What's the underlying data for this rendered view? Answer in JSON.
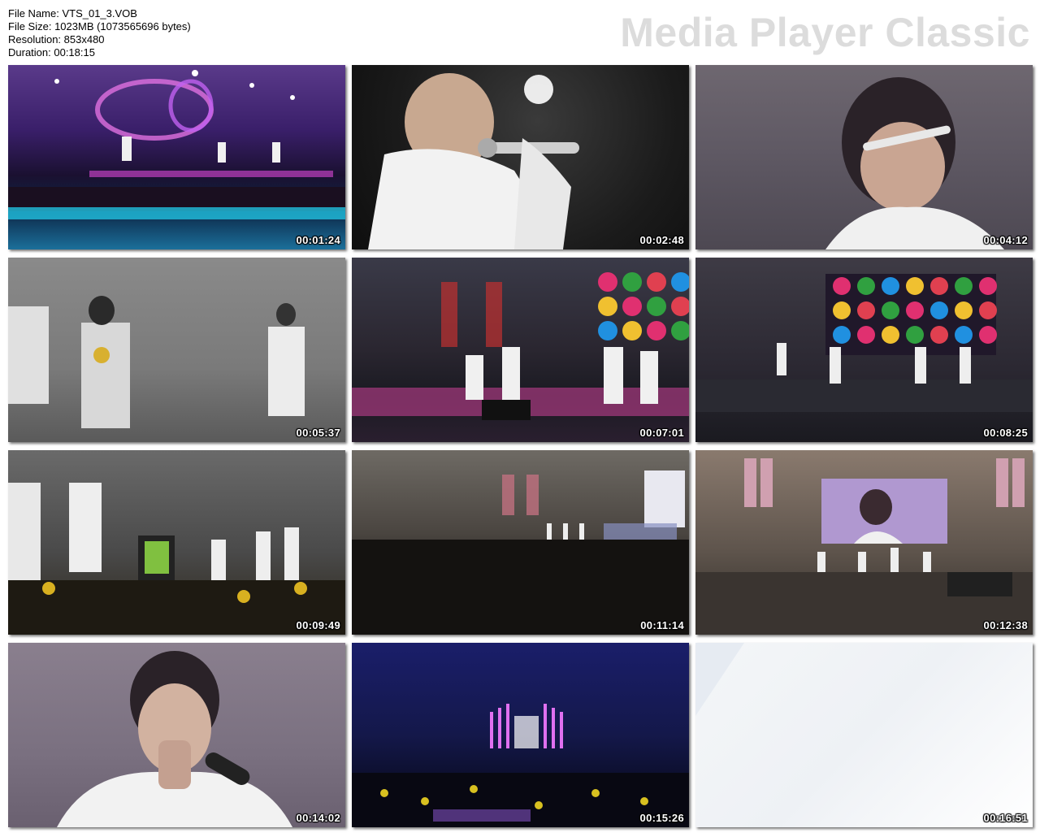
{
  "file_info": {
    "file_name": "File Name: VTS_01_3.VOB",
    "file_size": "File Size: 1023MB (1073565696 bytes)",
    "resolution": "Resolution: 853x480",
    "duration": "Duration: 00:18:15"
  },
  "brand": "Media Player Classic",
  "thumbnails": [
    {
      "timestamp": "00:01:24"
    },
    {
      "timestamp": "00:02:48"
    },
    {
      "timestamp": "00:04:12"
    },
    {
      "timestamp": "00:05:37"
    },
    {
      "timestamp": "00:07:01"
    },
    {
      "timestamp": "00:08:25"
    },
    {
      "timestamp": "00:09:49"
    },
    {
      "timestamp": "00:11:14"
    },
    {
      "timestamp": "00:12:38"
    },
    {
      "timestamp": "00:14:02"
    },
    {
      "timestamp": "00:15:26"
    },
    {
      "timestamp": "00:16:51"
    }
  ],
  "colors": {
    "brand_text": "#dcdcdc",
    "timestamp_text": "#ffffff",
    "background": "#ffffff"
  }
}
